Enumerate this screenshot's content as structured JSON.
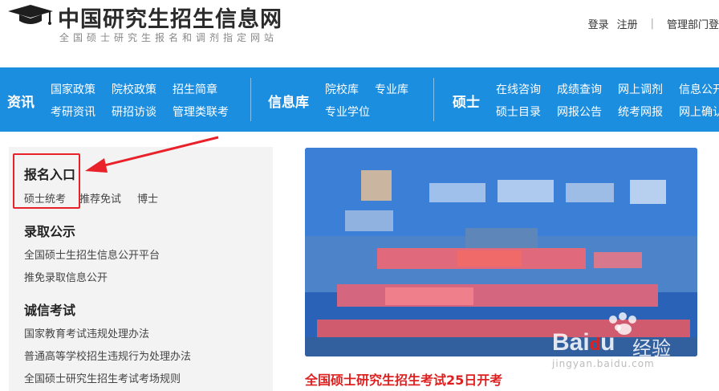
{
  "header": {
    "site_title": "中国研究生招生信息网",
    "site_subtitle": "全国硕士研究生报名和调剂指定网站",
    "links": {
      "login": "登录",
      "register": "注册",
      "divider": "|",
      "admin_login": "管理部门登"
    }
  },
  "nav": {
    "sections": [
      {
        "head": "资讯",
        "items": [
          "国家政策",
          "院校政策",
          "招生简章",
          "考研资讯",
          "研招访谈",
          "管理类联考"
        ]
      },
      {
        "head": "信息库",
        "items": [
          "院校库",
          "专业库",
          "专业学位"
        ]
      },
      {
        "head": "硕士",
        "items": [
          "在线咨询",
          "成绩查询",
          "网上调剂",
          "信息公开",
          "硕士目录",
          "网报公告",
          "统考网报",
          "网上确认"
        ]
      }
    ]
  },
  "sidebar": {
    "groups": [
      {
        "head": "报名入口",
        "links": [
          "硕士统考",
          "推荐免试",
          "博士"
        ]
      },
      {
        "head": "录取公示",
        "links": [
          "全国硕士生招生信息公开平台",
          "推免录取信息公开"
        ]
      },
      {
        "head": "诚信考试",
        "links": [
          "国家教育考试违规处理办法",
          "普通高等学校招生违规行为处理办法",
          "全国硕士研究生招生考试考场规则"
        ]
      }
    ]
  },
  "banner": {
    "caption": "全国硕士研究生招生考试25日开考"
  },
  "watermark": {
    "brand": "Bai",
    "brand_rest": "u",
    "brand_cn": "经验",
    "url": "jingyan.baidu.com"
  },
  "colors": {
    "nav_bg": "#1b8ee0",
    "highlight": "#e8212a",
    "caption": "#e02020",
    "panel_bg": "#f3f3f3"
  }
}
